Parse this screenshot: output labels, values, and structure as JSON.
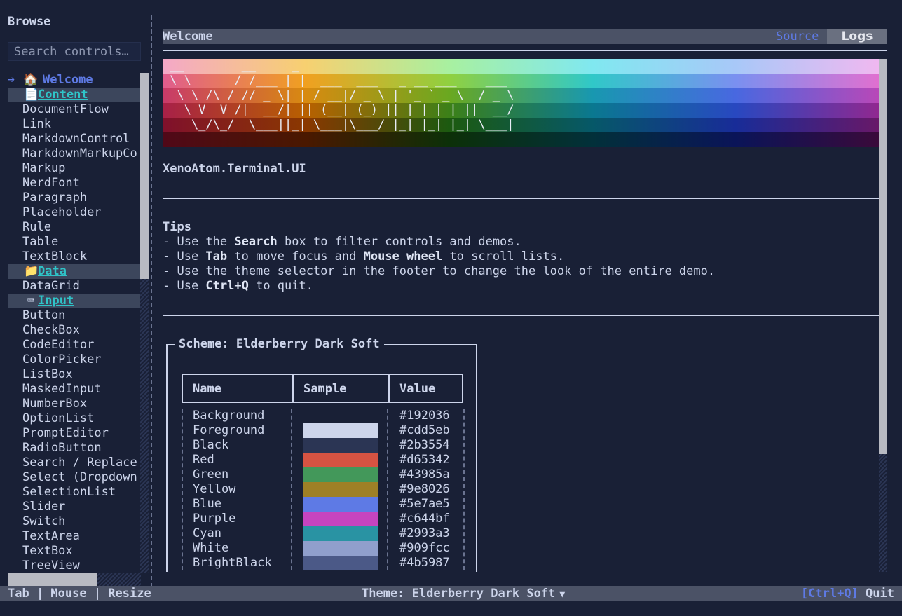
{
  "sidebar": {
    "title": "Browse",
    "search_placeholder": "Search controls…",
    "items": [
      {
        "kind": "active",
        "arrow": "➔",
        "icon": "🏠",
        "label": "Welcome"
      },
      {
        "kind": "group",
        "icon": "📄",
        "label": "Content"
      },
      {
        "kind": "child",
        "label": "DocumentFlow"
      },
      {
        "kind": "child",
        "label": "Link"
      },
      {
        "kind": "child",
        "label": "MarkdownControl"
      },
      {
        "kind": "child",
        "label": "MarkdownMarkupCo"
      },
      {
        "kind": "child",
        "label": "Markup"
      },
      {
        "kind": "child",
        "label": "NerdFont"
      },
      {
        "kind": "child",
        "label": "Paragraph"
      },
      {
        "kind": "child",
        "label": "Placeholder"
      },
      {
        "kind": "child",
        "label": "Rule"
      },
      {
        "kind": "child",
        "label": "Table"
      },
      {
        "kind": "child",
        "label": "TextBlock"
      },
      {
        "kind": "group",
        "icon": "📁",
        "label": "Data"
      },
      {
        "kind": "child",
        "label": "DataGrid"
      },
      {
        "kind": "group",
        "icon": "⌨",
        "label": "Input"
      },
      {
        "kind": "child",
        "label": "Button"
      },
      {
        "kind": "child",
        "label": "CheckBox"
      },
      {
        "kind": "child",
        "label": "CodeEditor"
      },
      {
        "kind": "child",
        "label": "ColorPicker"
      },
      {
        "kind": "child",
        "label": "ListBox"
      },
      {
        "kind": "child",
        "label": "MaskedInput"
      },
      {
        "kind": "child",
        "label": "NumberBox"
      },
      {
        "kind": "child",
        "label": "OptionList"
      },
      {
        "kind": "child",
        "label": "PromptEditor"
      },
      {
        "kind": "child",
        "label": "RadioButton"
      },
      {
        "kind": "child",
        "label": "Search / Replace"
      },
      {
        "kind": "child",
        "label": "Select (Dropdown"
      },
      {
        "kind": "child",
        "label": "SelectionList"
      },
      {
        "kind": "child",
        "label": "Slider"
      },
      {
        "kind": "child",
        "label": "Switch"
      },
      {
        "kind": "child",
        "label": "TextArea"
      },
      {
        "kind": "child",
        "label": "TextBox"
      },
      {
        "kind": "child",
        "label": "TreeView"
      }
    ]
  },
  "tabs": {
    "welcome": "Welcome",
    "source": "Source",
    "logs": "Logs"
  },
  "banner": {
    "ascii": [
      " __        __     _                                   ",
      " \\ \\      / /___ | |  ___  ___   _ __ ___    ___      ",
      "  \\ \\ /\\ / // _ \\| | / __|/ _ \\ | '_ ` _ \\  / _ \\     ",
      "   \\ V  V /|  __/| || (__| (_) || | | | | ||  __/     ",
      "    \\_/\\_/  \\___||_| \\___|\\___/ |_| |_| |_| \\___|     "
    ],
    "band_colors": [
      [
        "#f4a8c8",
        "#f7d070",
        "#a8f0a0",
        "#80e8f0",
        "#a8c8f8",
        "#f0b8f0"
      ],
      [
        "#e05c8e",
        "#f0a020",
        "#90d040",
        "#30c8c8",
        "#7a90f0",
        "#e070d0"
      ],
      [
        "#c83a6a",
        "#d88a10",
        "#6aa820",
        "#1898b0",
        "#4868e0",
        "#b848b8"
      ],
      [
        "#a82048",
        "#b86000",
        "#3c8018",
        "#0a7890",
        "#2848c0",
        "#902890"
      ],
      [
        "#80102c",
        "#8a3800",
        "#1c5a10",
        "#065868",
        "#182c98",
        "#681868"
      ],
      [
        "#500818",
        "#4a1800",
        "#0c3008",
        "#02303a",
        "#0a1458",
        "#3a0a3a"
      ]
    ]
  },
  "content": {
    "app_name": "XenoAtom.Terminal.UI",
    "tips_title": "Tips",
    "tips": [
      {
        "pre": "- Use the ",
        "b": "Search",
        "post": " box to filter controls and demos.",
        "b2": "",
        "post2": ""
      },
      {
        "pre": "- Use ",
        "b": "Tab",
        "post": " to move focus and ",
        "b2": "Mouse wheel",
        "post2": " to scroll lists."
      },
      {
        "pre": "- Use the theme selector in the footer to change the look of the entire demo.",
        "b": "",
        "post": "",
        "b2": "",
        "post2": ""
      },
      {
        "pre": "- Use ",
        "b": "Ctrl+Q",
        "post": " to quit.",
        "b2": "",
        "post2": ""
      }
    ]
  },
  "scheme": {
    "title": "Scheme: Elderberry Dark Soft",
    "headers": {
      "name": "Name",
      "sample": "Sample",
      "value": "Value"
    },
    "rows": [
      {
        "name": "Background",
        "value": "#192036",
        "color": "#192036"
      },
      {
        "name": "Foreground",
        "value": "#cdd5eb",
        "color": "#cdd5eb"
      },
      {
        "name": "Black",
        "value": "#2b3554",
        "color": "#2b3554"
      },
      {
        "name": "Red",
        "value": "#d65342",
        "color": "#d65342"
      },
      {
        "name": "Green",
        "value": "#43985a",
        "color": "#43985a"
      },
      {
        "name": "Yellow",
        "value": "#9e8026",
        "color": "#9e8026"
      },
      {
        "name": "Blue",
        "value": "#5e7ae5",
        "color": "#5e7ae5"
      },
      {
        "name": "Purple",
        "value": "#c644bf",
        "color": "#c644bf"
      },
      {
        "name": "Cyan",
        "value": "#2993a3",
        "color": "#2993a3"
      },
      {
        "name": "White",
        "value": "#909fcc",
        "color": "#909fcc"
      },
      {
        "name": "BrightBlack",
        "value": "#4b5987",
        "color": "#4b5987"
      }
    ]
  },
  "footer": {
    "left": "Tab | Mouse | Resize",
    "theme": "Theme: Elderberry Dark Soft",
    "caret": "▼",
    "quit_key": "[Ctrl+Q]",
    "quit_label": "Quit"
  }
}
